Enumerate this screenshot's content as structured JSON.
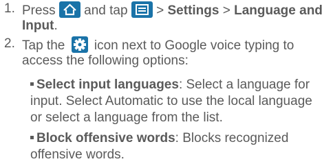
{
  "steps": [
    {
      "number": "1.",
      "text_press": "Press",
      "text_and_tap": "and tap",
      "sep": ">",
      "settings": "Settings",
      "lang_input_a": "Language and",
      "lang_input_b": "Input",
      "period": "."
    },
    {
      "number": "2.",
      "text_tap_the": "Tap the",
      "line1_rest": "icon next to Google voice typing to",
      "line2": "access the following options:"
    }
  ],
  "options": [
    {
      "title": "Select input languages",
      "line1_rest": ": Select a language for",
      "line2": "input. Select Automatic to use the local language",
      "line3": "or select a language from the list."
    },
    {
      "title": "Block offensive words",
      "line1_rest": ": Blocks recognized",
      "line2": "offensive words."
    }
  ],
  "icons": [
    "home-icon",
    "menu-icon",
    "gear-icon"
  ],
  "colors": {
    "text": "#5a5a5a",
    "icon_bg": "#1a73a8"
  }
}
